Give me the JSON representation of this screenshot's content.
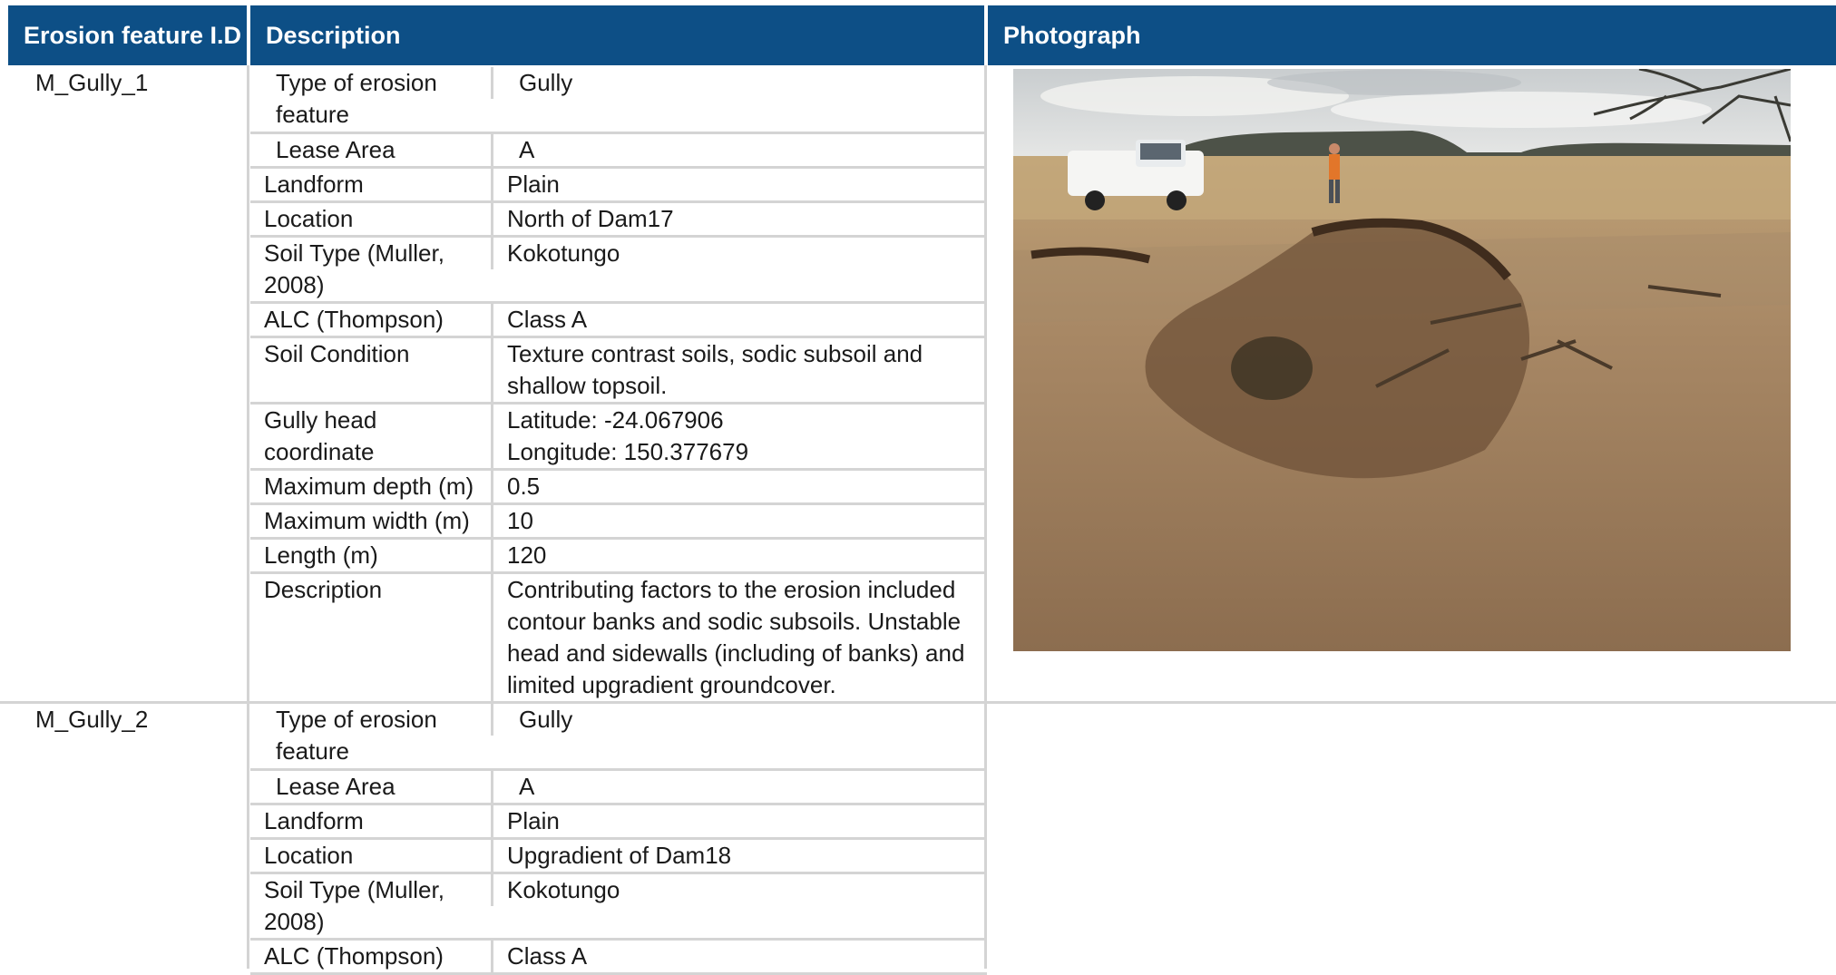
{
  "header": {
    "col1": "Erosion feature I.D",
    "col2": "Description",
    "col3": "Photograph"
  },
  "features": [
    {
      "id": "M_Gully_1",
      "rows": [
        {
          "key": "Type of erosion feature",
          "value": "Gully"
        },
        {
          "key": "Lease Area",
          "value": "A"
        },
        {
          "key": "Landform",
          "value": "Plain"
        },
        {
          "key": "Location",
          "value": "North of Dam17"
        },
        {
          "key": "Soil Type (Muller, 2008)",
          "value": "Kokotungo"
        },
        {
          "key": "ALC (Thompson)",
          "value": "Class A"
        },
        {
          "key": "Soil Condition",
          "value": "Texture contrast soils, sodic subsoil and shallow topsoil."
        },
        {
          "key": "Gully head coordinate",
          "value_lines": [
            "Latitude: -24.067906",
            "Longitude: 150.377679"
          ]
        },
        {
          "key": "Maximum depth (m)",
          "value": "0.5"
        },
        {
          "key": "Maximum width (m)",
          "value": "10"
        },
        {
          "key": "Length (m)",
          "value": "120"
        },
        {
          "key": "Description",
          "value": "Contributing factors to the erosion included contour banks and sodic subsoils. Unstable head and sidewalls (including of banks) and limited upgradient groundcover."
        }
      ]
    },
    {
      "id": "M_Gully_2",
      "rows": [
        {
          "key": "Type of erosion feature",
          "value": "Gully"
        },
        {
          "key": "Lease Area",
          "value": "A"
        },
        {
          "key": "Landform",
          "value": "Plain"
        },
        {
          "key": "Location",
          "value": "Upgradient of Dam18"
        },
        {
          "key": "Soil Type (Muller, 2008)",
          "value": "Kokotungo"
        },
        {
          "key": "ALC (Thompson)",
          "value": "Class A"
        }
      ]
    }
  ],
  "photo": {
    "colors": {
      "sky": "#d9dcdc",
      "ground": "#9a7a58",
      "grass": "#b69a6a",
      "hills": "#4d5248"
    }
  }
}
